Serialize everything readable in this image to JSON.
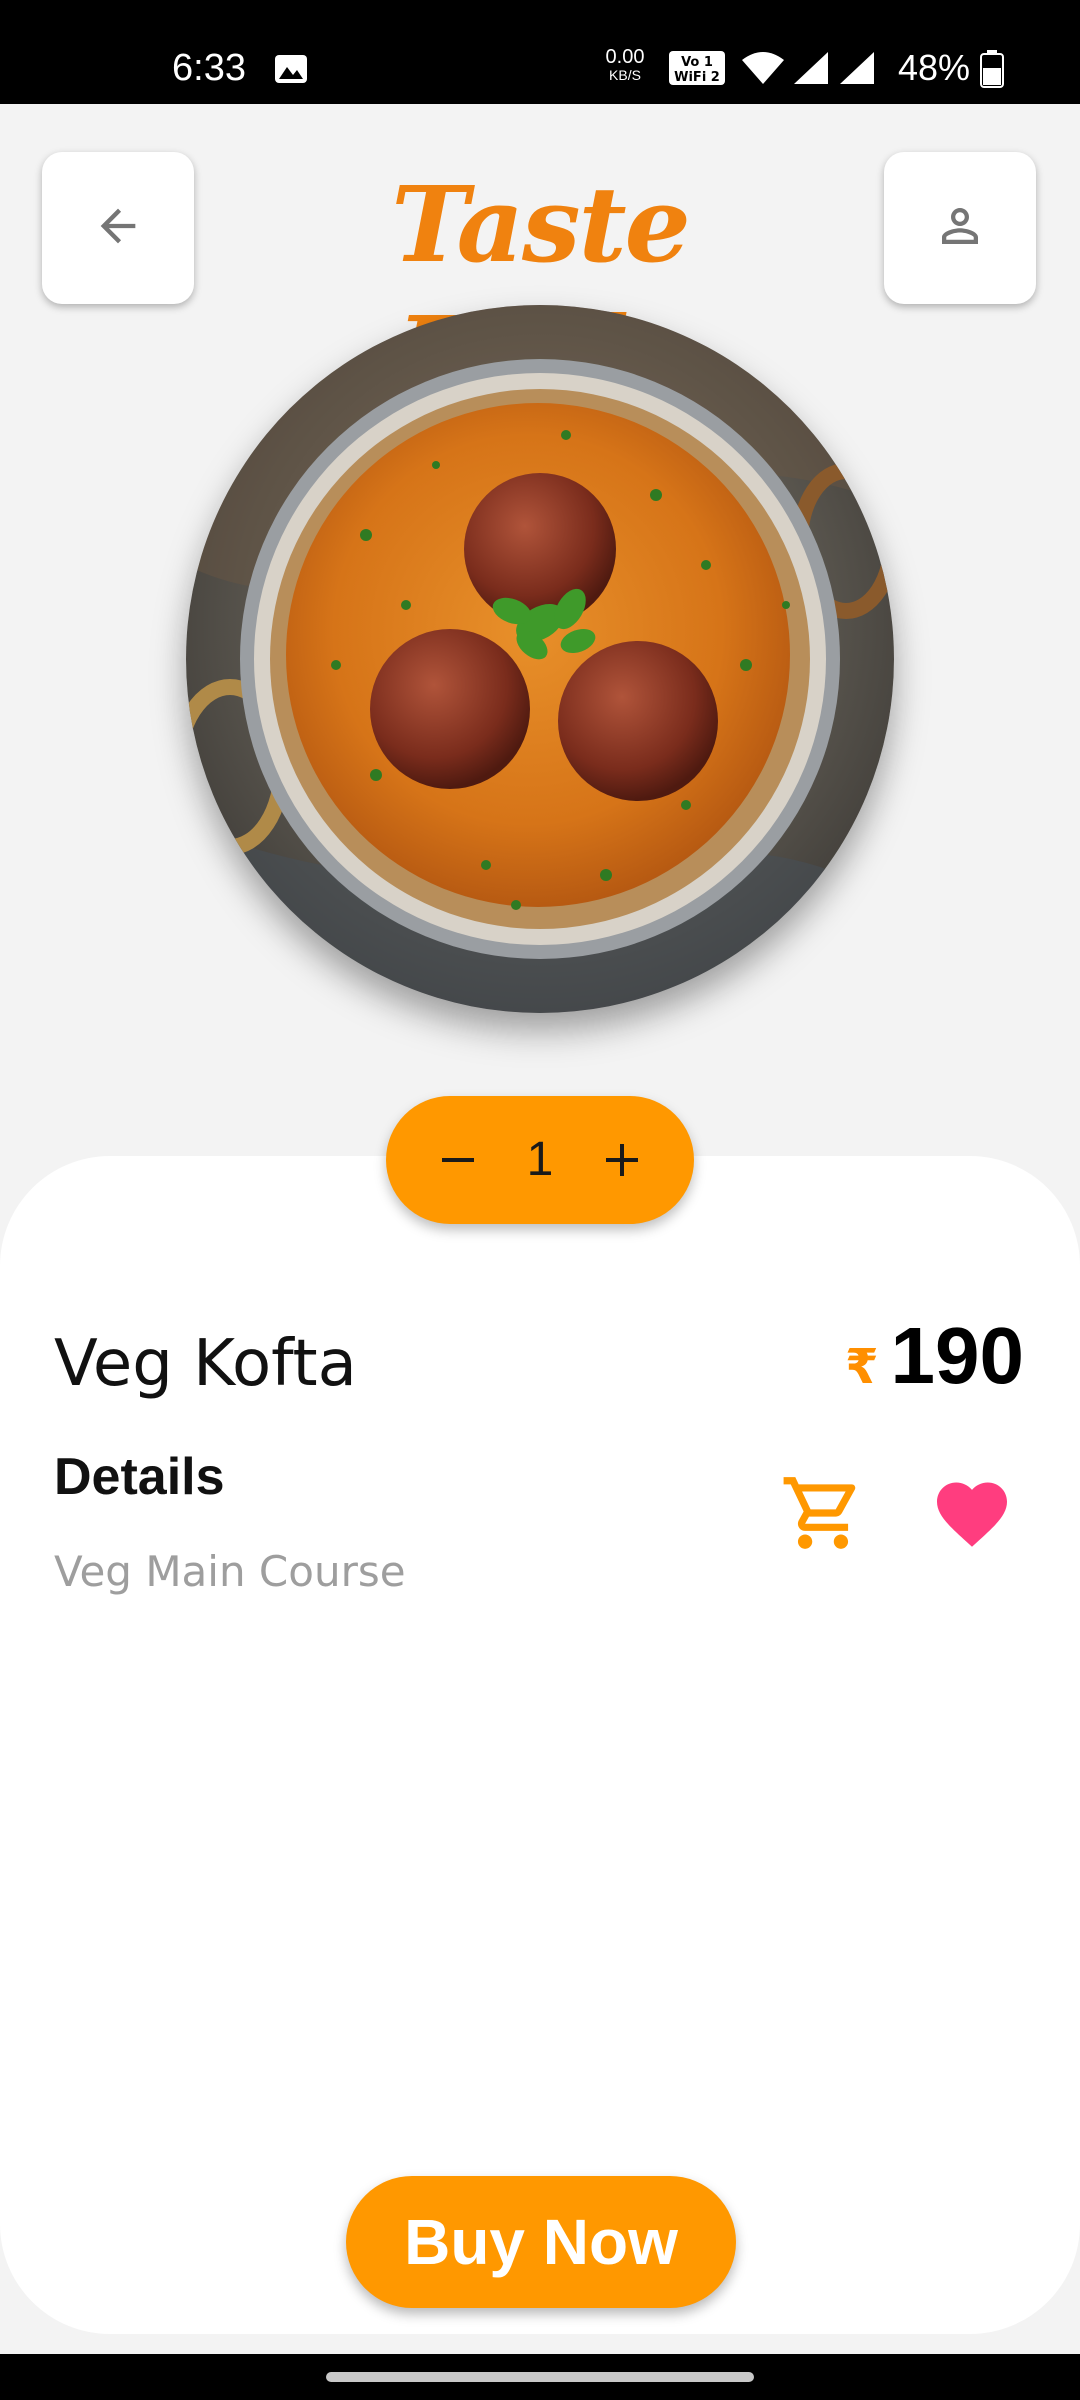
{
  "status_bar": {
    "time": "6:33",
    "net_speed_value": "0.00",
    "net_speed_unit": "KB/S",
    "volte_label": "Vo) 1 WiFi 2",
    "battery": "48%",
    "icons": [
      "gallery-icon",
      "volte-wifi-icon",
      "wifi-icon",
      "signal-icon",
      "signal-icon",
      "battery-icon"
    ]
  },
  "header": {
    "title": "Taste Buds",
    "back_icon": "arrow-left-icon",
    "profile_icon": "person-icon",
    "title_color": "#f0820f"
  },
  "dish": {
    "image_alt": "Veg Kofta dish photo"
  },
  "quantity": {
    "value": "1",
    "minus_icon": "minus-icon",
    "plus_icon": "plus-icon"
  },
  "item": {
    "name": "Veg Kofta",
    "currency": "₹",
    "price": "190",
    "details_heading": "Details",
    "details_text": "Veg Main Course",
    "cart_icon": "cart-icon",
    "favorite_icon": "heart-icon"
  },
  "actions": {
    "buy_label": "Buy Now"
  },
  "colors": {
    "accent": "#ff9800",
    "heart": "#ff3d7f",
    "background": "#f3f3f3",
    "card": "#ffffff"
  }
}
